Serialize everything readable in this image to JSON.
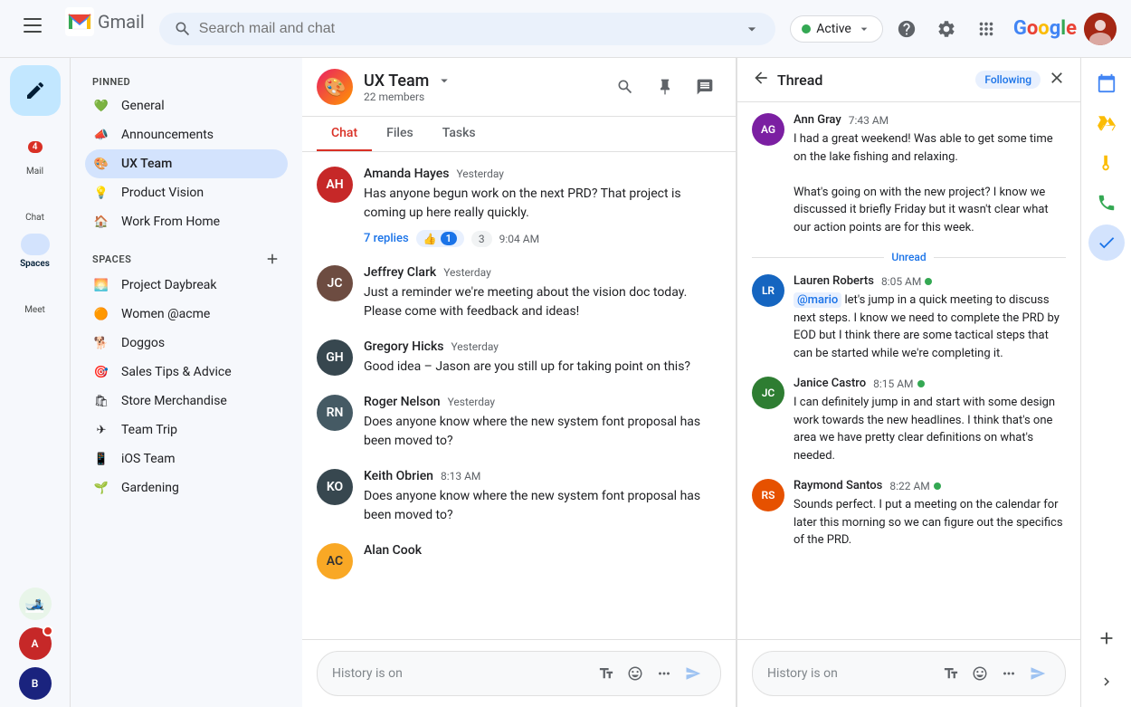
{
  "app": {
    "title": "Gmail"
  },
  "topbar": {
    "search_placeholder": "Search mail and chat",
    "status": "Active",
    "google_text": "Google"
  },
  "leftnav": {
    "compose_icon": "✏",
    "items": [
      {
        "id": "mail",
        "label": "Mail",
        "badge": 4,
        "active": false
      },
      {
        "id": "chat",
        "label": "Chat",
        "badge": null,
        "active": false
      },
      {
        "id": "spaces",
        "label": "Spaces",
        "badge": null,
        "active": true
      },
      {
        "id": "meet",
        "label": "Meet",
        "badge": null,
        "active": false
      }
    ]
  },
  "sidebar": {
    "pinned_label": "PINNED",
    "spaces_label": "SPACES",
    "pinned_items": [
      {
        "id": "general",
        "label": "General",
        "icon": "💚",
        "active": false
      },
      {
        "id": "announcements",
        "label": "Announcements",
        "icon": "📣",
        "active": false
      },
      {
        "id": "uxteam",
        "label": "UX Team",
        "icon": "🎨",
        "active": true
      },
      {
        "id": "productvision",
        "label": "Product Vision",
        "icon": "💡",
        "active": false
      },
      {
        "id": "workfromhome",
        "label": "Work From Home",
        "icon": "🏠",
        "active": false
      }
    ],
    "spaces_items": [
      {
        "id": "projectdaybreak",
        "label": "Project Daybreak",
        "icon": "🌅",
        "active": false
      },
      {
        "id": "womenacme",
        "label": "Women @acme",
        "icon": "🟠",
        "active": false
      },
      {
        "id": "doggos",
        "label": "Doggos",
        "icon": "🐕",
        "active": false
      },
      {
        "id": "salestips",
        "label": "Sales Tips & Advice",
        "icon": "🎯",
        "active": false
      },
      {
        "id": "storemerchandise",
        "label": "Store Merchandise",
        "icon": "🛍",
        "active": false
      },
      {
        "id": "teamtrip",
        "label": "Team Trip",
        "icon": "✈",
        "active": false
      },
      {
        "id": "iosteam",
        "label": "iOS Team",
        "icon": "📱",
        "active": false
      },
      {
        "id": "gardening",
        "label": "Gardening",
        "icon": "🌱",
        "active": false
      }
    ]
  },
  "chat": {
    "team_name": "UX Team",
    "member_count": "22 members",
    "tabs": [
      {
        "id": "chat",
        "label": "Chat",
        "active": true
      },
      {
        "id": "files",
        "label": "Files",
        "active": false
      },
      {
        "id": "tasks",
        "label": "Tasks",
        "active": false
      }
    ],
    "messages": [
      {
        "id": 1,
        "name": "Amanda Hayes",
        "time": "Yesterday",
        "text": "Has anyone begun work on the next PRD? That project is coming up here really quickly.",
        "reply_count": "7 replies",
        "reaction": "1",
        "reaction_count": "3",
        "reply_time": "9:04 AM",
        "avatar_bg": "#c62828",
        "initials": "AH"
      },
      {
        "id": 2,
        "name": "Jeffrey Clark",
        "time": "Yesterday",
        "text": "Just a reminder we're meeting about the vision doc today. Please come with feedback and ideas!",
        "avatar_bg": "#6d4c41",
        "initials": "JC"
      },
      {
        "id": 3,
        "name": "Gregory Hicks",
        "time": "Yesterday",
        "text": "Good idea – Jason are you still up for taking point on this?",
        "avatar_bg": "#37474f",
        "initials": "GH"
      },
      {
        "id": 4,
        "name": "Roger Nelson",
        "time": "Yesterday",
        "text": "Does anyone know where the new system font proposal has been moved to?",
        "avatar_bg": "#455a64",
        "initials": "RN"
      },
      {
        "id": 5,
        "name": "Keith Obrien",
        "time": "8:13 AM",
        "text": "Does anyone know where the new system font proposal has been moved to?",
        "avatar_bg": "#37474f",
        "initials": "KO"
      },
      {
        "id": 6,
        "name": "Alan Cook",
        "time": "",
        "text": "",
        "avatar_bg": "#f9a825",
        "initials": "AC"
      }
    ],
    "input_placeholder": "History is on"
  },
  "thread": {
    "title": "Thread",
    "following_label": "Following",
    "messages": [
      {
        "id": 1,
        "name": "Ann Gray",
        "time": "7:43 AM",
        "online": false,
        "text": "I had a great weekend! Was able to get some time on the lake fishing and relaxing.\n\nWhat's going on with the new project? I know we discussed it briefly Friday but it wasn't clear what our action points are for this week.",
        "avatar_bg": "#7b1fa2",
        "initials": "AG"
      },
      {
        "id": 2,
        "name": "Lauren Roberts",
        "time": "8:05 AM",
        "online": true,
        "text": "@mario let's jump in a quick meeting to discuss next steps. I know we need to complete the PRD by EOD but I think there are some tactical steps that can be started while we're completing it.",
        "mention": "@mario",
        "avatar_bg": "#1565c0",
        "initials": "LR"
      },
      {
        "id": 3,
        "name": "Janice Castro",
        "time": "8:15 AM",
        "online": true,
        "text": "I can definitely jump in and start with some design work towards the new headlines. I think that's one area we have pretty clear definitions on what's needed.",
        "avatar_bg": "#2e7d32",
        "initials": "JC"
      },
      {
        "id": 4,
        "name": "Raymond Santos",
        "time": "8:22 AM",
        "online": true,
        "text": "Sounds perfect. I put a meeting on the calendar for later this morning so we can figure out the specifics of the PRD.",
        "avatar_bg": "#e65100",
        "initials": "RS"
      }
    ],
    "unread_label": "Unread",
    "input_placeholder": "History is on"
  },
  "rightbar": {
    "items": [
      {
        "id": "calendar",
        "icon": "📅",
        "label": "calendar-icon"
      },
      {
        "id": "drive",
        "icon": "▲",
        "label": "drive-icon"
      },
      {
        "id": "keep",
        "icon": "💛",
        "label": "keep-icon"
      },
      {
        "id": "phone",
        "icon": "📞",
        "label": "phone-icon"
      },
      {
        "id": "tasks",
        "icon": "✓",
        "label": "tasks-icon"
      },
      {
        "id": "add",
        "icon": "+",
        "label": "add-icon"
      }
    ]
  }
}
